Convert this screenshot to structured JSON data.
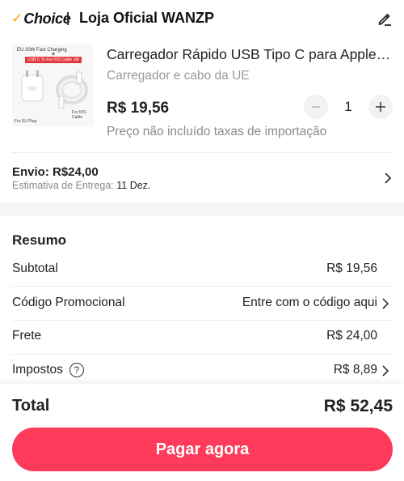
{
  "header": {
    "choice_label": "Choice",
    "store_name": "Loja Oficial WANZP"
  },
  "product": {
    "image_text_top": "EU 20W Fast Charging",
    "image_text_red": "USB C To For IOS Cable 1M",
    "image_caption_left": "For EU Plug",
    "image_caption_right": "For IOS Cable",
    "title": "Carregador Rápido USB Tipo C para Apple iPhone",
    "variant": "Carregador e cabo da UE",
    "price": "R$ 19,56",
    "quantity": "1",
    "tax_note": "Preço não incluído taxas de importação"
  },
  "shipping": {
    "cost": "Envio: R$24,00",
    "eta_label": "Estimativa de Entrega:",
    "eta_date": "11 Dez."
  },
  "summary": {
    "title": "Resumo",
    "rows": [
      {
        "label": "Subtotal",
        "value": "R$ 19,56"
      },
      {
        "label": "Código Promocional",
        "value": "Entre com o código aqui"
      },
      {
        "label": "Frete",
        "value": "R$ 24,00"
      },
      {
        "label": "Impostos",
        "value": "R$ 8,89"
      }
    ]
  },
  "footer": {
    "total_label": "Total",
    "total_value": "R$ 52,45",
    "pay_label": "Pagar agora"
  },
  "colors": {
    "accent": "#fe3b5a",
    "choice_check": "#f7a600"
  }
}
